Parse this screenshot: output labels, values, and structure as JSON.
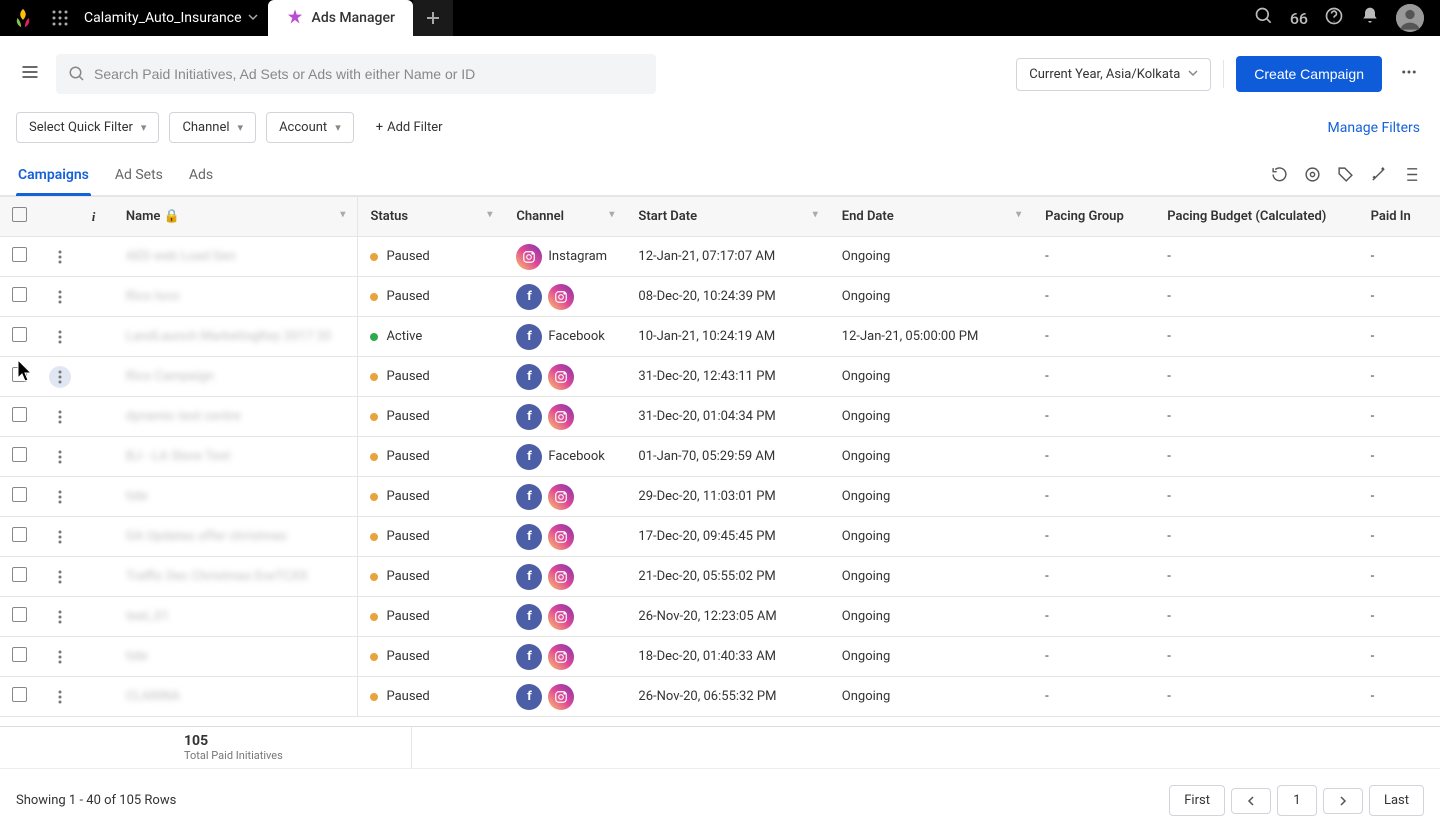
{
  "topbar": {
    "project_name": "Calamity_Auto_Insurance",
    "active_tab": "Ads Manager",
    "quote_count": "66"
  },
  "search": {
    "placeholder": "Search Paid Initiatives, Ad Sets or Ads with either Name or ID"
  },
  "date_range": "Current Year, Asia/Kolkata",
  "create_button": "Create Campaign",
  "filters": {
    "quick_filter": "Select Quick Filter",
    "channel": "Channel",
    "account": "Account",
    "add_filter": "Add Filter",
    "manage": "Manage Filters"
  },
  "tabs": [
    "Campaigns",
    "Ad Sets",
    "Ads"
  ],
  "active_tab_index": 0,
  "columns": {
    "name": "Name",
    "status": "Status",
    "channel": "Channel",
    "start": "Start Date",
    "end": "End Date",
    "pacing_group": "Pacing Group",
    "pacing_budget": "Pacing Budget (Calculated)",
    "paid": "Paid In"
  },
  "rows": [
    {
      "name": "AED web Load Gen",
      "status": "Paused",
      "channels": [
        "Instagram"
      ],
      "channel_label": "Instagram",
      "start": "12-Jan-21, 07:17:07 AM",
      "end": "Ongoing",
      "pg": "-",
      "pb": "-",
      "paid": "-"
    },
    {
      "name": "Rico loco",
      "status": "Paused",
      "channels": [
        "Facebook",
        "Instagram"
      ],
      "start": "08-Dec-20, 10:24:39 PM",
      "end": "Ongoing",
      "pg": "-",
      "pb": "-",
      "paid": "-"
    },
    {
      "name": "LandLaunch MarketingKey 2017 20",
      "status": "Active",
      "channels": [
        "Facebook"
      ],
      "channel_label": "Facebook",
      "start": "10-Jan-21, 10:24:19 AM",
      "end": "12-Jan-21, 05:00:00 PM",
      "pg": "-",
      "pb": "-",
      "paid": "-"
    },
    {
      "name": "Rico Campaign",
      "status": "Paused",
      "channels": [
        "Facebook",
        "Instagram"
      ],
      "start": "31-Dec-20, 12:43:11 PM",
      "end": "Ongoing",
      "pg": "-",
      "pb": "-",
      "paid": "-",
      "menu_highlighted": true
    },
    {
      "name": "dynamic test centre",
      "status": "Paused",
      "channels": [
        "Facebook",
        "Instagram"
      ],
      "start": "31-Dec-20, 01:04:34 PM",
      "end": "Ongoing",
      "pg": "-",
      "pb": "-",
      "paid": "-"
    },
    {
      "name": "BJ - LA Store Test",
      "status": "Paused",
      "channels": [
        "Facebook"
      ],
      "channel_label": "Facebook",
      "start": "01-Jan-70, 05:29:59 AM",
      "end": "Ongoing",
      "pg": "-",
      "pb": "-",
      "paid": "-"
    },
    {
      "name": "tide",
      "status": "Paused",
      "channels": [
        "Facebook",
        "Instagram"
      ],
      "start": "29-Dec-20, 11:03:01 PM",
      "end": "Ongoing",
      "pg": "-",
      "pb": "-",
      "paid": "-"
    },
    {
      "name": "GA Updates offer christmas",
      "status": "Paused",
      "channels": [
        "Facebook",
        "Instagram"
      ],
      "start": "17-Dec-20, 09:45:45 PM",
      "end": "Ongoing",
      "pg": "-",
      "pb": "-",
      "paid": "-"
    },
    {
      "name": "Traffic Dec Christmas EveTCXX",
      "status": "Paused",
      "channels": [
        "Facebook",
        "Instagram"
      ],
      "start": "21-Dec-20, 05:55:02 PM",
      "end": "Ongoing",
      "pg": "-",
      "pb": "-",
      "paid": "-"
    },
    {
      "name": "teat_01",
      "status": "Paused",
      "channels": [
        "Facebook",
        "Instagram"
      ],
      "start": "26-Nov-20, 12:23:05 AM",
      "end": "Ongoing",
      "pg": "-",
      "pb": "-",
      "paid": "-"
    },
    {
      "name": "tide",
      "status": "Paused",
      "channels": [
        "Facebook",
        "Instagram"
      ],
      "start": "18-Dec-20, 01:40:33 AM",
      "end": "Ongoing",
      "pg": "-",
      "pb": "-",
      "paid": "-"
    },
    {
      "name": "CLARINA",
      "status": "Paused",
      "channels": [
        "Facebook",
        "Instagram"
      ],
      "start": "26-Nov-20, 06:55:32 PM",
      "end": "Ongoing",
      "pg": "-",
      "pb": "-",
      "paid": "-"
    }
  ],
  "totals": {
    "count": "105",
    "label": "Total Paid Initiatives"
  },
  "pagination": {
    "showing": "Showing 1 - 40 of 105 Rows",
    "first": "First",
    "last": "Last",
    "page": "1"
  }
}
